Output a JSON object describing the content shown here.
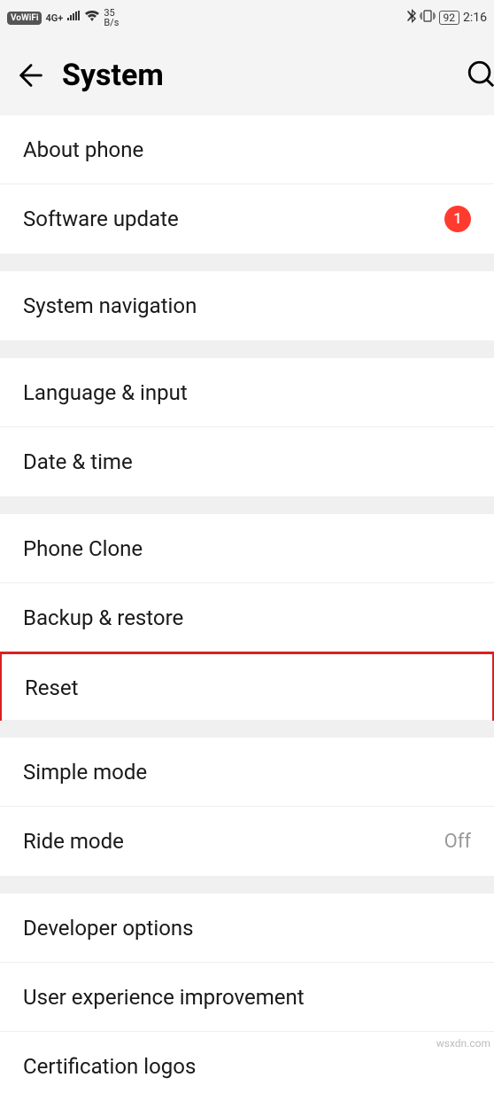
{
  "status": {
    "vowifi": "VoWiFi",
    "network": "4G+",
    "speed_num": "35",
    "speed_unit": "B/s",
    "battery": "92",
    "time": "2:16"
  },
  "header": {
    "title": "System"
  },
  "groups": [
    {
      "items": [
        {
          "key": "about-phone",
          "label": "About phone",
          "value": "",
          "badge": ""
        },
        {
          "key": "software-update",
          "label": "Software update",
          "value": "",
          "badge": "1"
        }
      ]
    },
    {
      "items": [
        {
          "key": "system-navigation",
          "label": "System navigation",
          "value": "",
          "badge": ""
        }
      ]
    },
    {
      "items": [
        {
          "key": "language-input",
          "label": "Language & input",
          "value": "",
          "badge": ""
        },
        {
          "key": "date-time",
          "label": "Date & time",
          "value": "",
          "badge": ""
        }
      ]
    },
    {
      "items": [
        {
          "key": "phone-clone",
          "label": "Phone Clone",
          "value": "",
          "badge": ""
        },
        {
          "key": "backup-restore",
          "label": "Backup & restore",
          "value": "",
          "badge": ""
        },
        {
          "key": "reset",
          "label": "Reset",
          "value": "",
          "badge": "",
          "highlight": true
        }
      ]
    },
    {
      "items": [
        {
          "key": "simple-mode",
          "label": "Simple mode",
          "value": "",
          "badge": ""
        },
        {
          "key": "ride-mode",
          "label": "Ride mode",
          "value": "Off",
          "badge": ""
        }
      ]
    },
    {
      "items": [
        {
          "key": "developer-options",
          "label": "Developer options",
          "value": "",
          "badge": ""
        },
        {
          "key": "user-experience",
          "label": "User experience improvement",
          "value": "",
          "badge": ""
        },
        {
          "key": "certification-logos",
          "label": "Certification logos",
          "value": "",
          "badge": ""
        }
      ]
    }
  ],
  "watermark": "wsxdn.com"
}
